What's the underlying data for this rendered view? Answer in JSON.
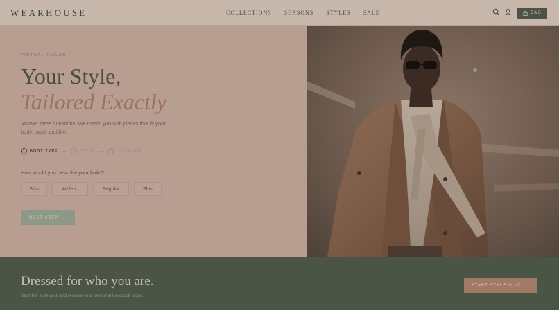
{
  "brand": {
    "logo": "WEARHOUSE"
  },
  "nav": {
    "items": [
      "COLLECTIONS",
      "SEASONS",
      "STYLES",
      "SALE"
    ]
  },
  "header": {
    "bag_label": "BAG",
    "icons": [
      "search-icon",
      "user-icon",
      "bag-icon"
    ]
  },
  "hero": {
    "eyebrow": "VIRTUAL TAILOR",
    "title_line1": "Your Style,",
    "title_line2": "Tailored Exactly",
    "description": "Answer three questions. We match you with pieces that fit your body, taste, and life.",
    "steps": [
      {
        "num": "1",
        "label": "BODY TYPE",
        "active": true
      },
      {
        "num": "2",
        "label": "STYLE",
        "active": false
      },
      {
        "num": "3",
        "label": "OCCASION",
        "active": false
      }
    ],
    "question": "How would you describe your build?",
    "options": [
      "Slim",
      "Athletic",
      "Regular",
      "Plus"
    ],
    "next_label": "NEXT STEP",
    "next_arrow": "→"
  },
  "band": {
    "title": "Dressed for who you are.",
    "subtitle": "Start the style quiz and receive your personal lookbook today.",
    "cta_label": "START STYLE QUIZ",
    "cta_arrow": "→"
  },
  "colors": {
    "accent_green": "#4a5346",
    "accent_terracotta": "#9d6f5c",
    "hero_bg": "#b89e90"
  }
}
